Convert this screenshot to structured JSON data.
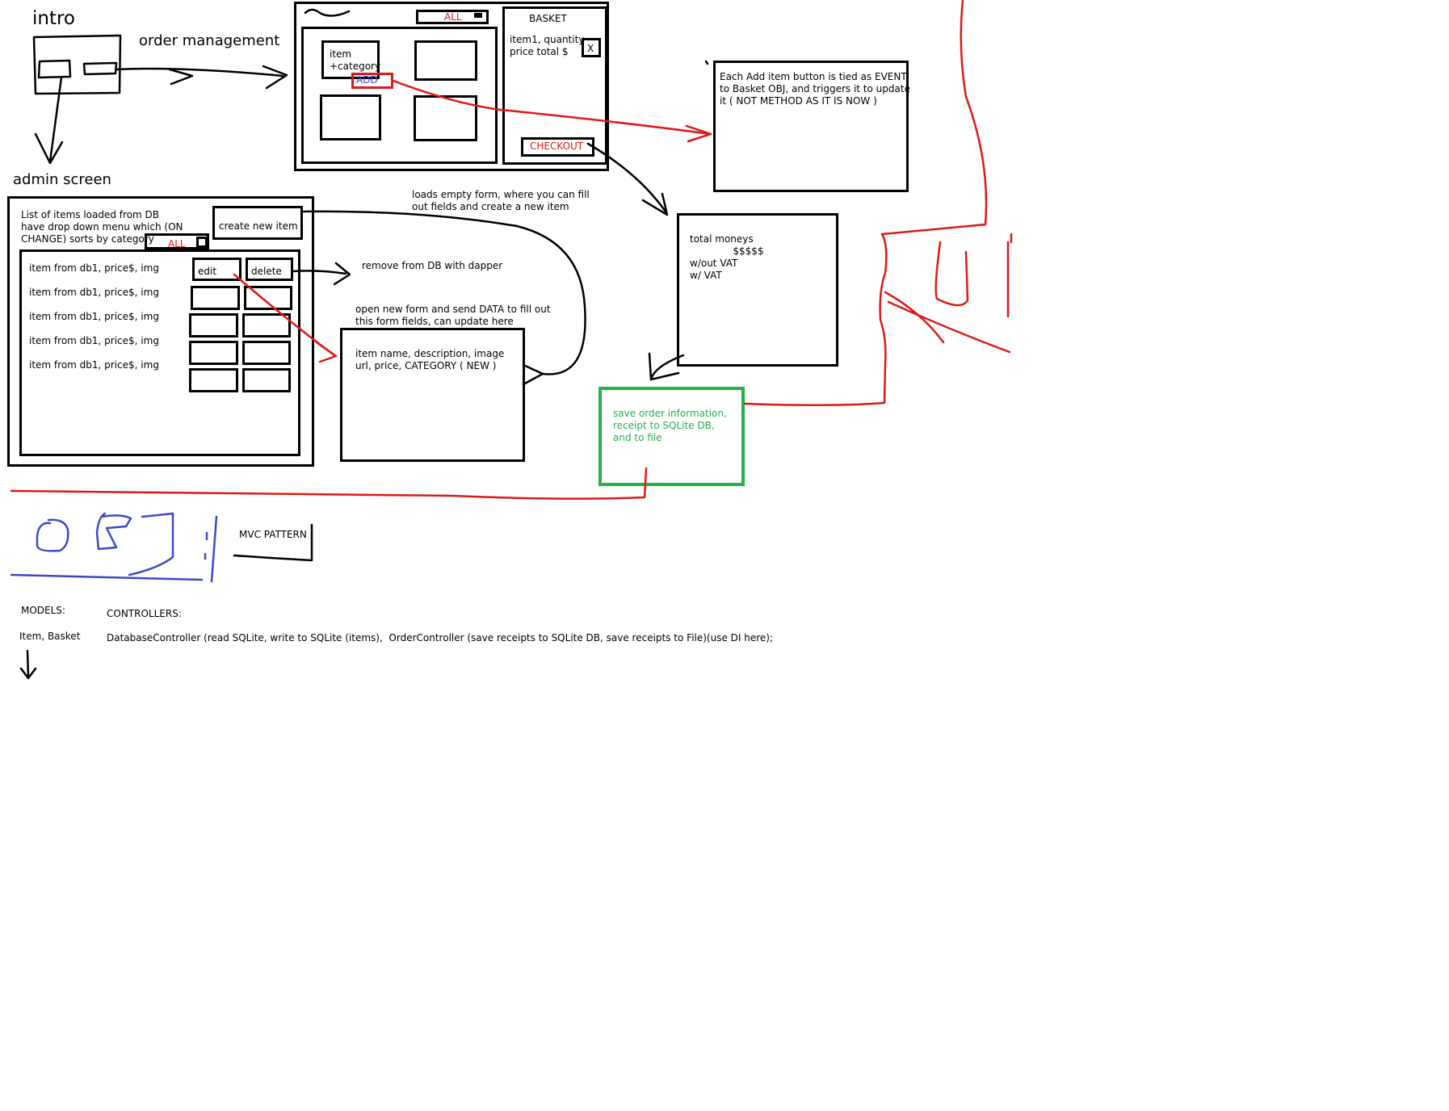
{
  "intro": {
    "title": "intro"
  },
  "order_management": {
    "label": "order management"
  },
  "admin_screen": {
    "label": "admin screen"
  },
  "order_screen": {
    "filter_value": "ALL",
    "item_label": "item\n+category",
    "add_label": "ADD",
    "basket": {
      "title": "BASKET",
      "line": "item1, quantity\nprice total $",
      "remove_label": "X",
      "checkout_label": "CHECKOUT"
    }
  },
  "event_note": "Each Add item button is tied as EVENT\nto Basket OBJ, and triggers it to update\nit ( NOT METHOD AS IT IS NOW )",
  "totals": {
    "text": "total moneys\n              $$$$$\nw/out VAT\nw/ VAT"
  },
  "admin_panel": {
    "description": "List of items loaded from DB\nhave drop down menu which (ON\nCHANGE) sorts by category",
    "create_label": "create new item",
    "filter_value": "ALL",
    "rows": [
      "item from db1, price$, img",
      "item from db1, price$, img",
      "item from db1, price$, img",
      "item from db1, price$, img",
      "item from db1, price$, img"
    ],
    "edit_label": "edit",
    "delete_label": "delete"
  },
  "notes": {
    "loads_empty_form": "loads empty form, where you can fill\nout fields and create a new item",
    "remove_from_db": "remove from DB with dapper",
    "open_new_form": "open new form and send DATA to fill out\nthis form fields, can update here"
  },
  "item_form": {
    "text": "item name, description, image\nurl, price, CATEGORY ( NEW )"
  },
  "save_order": {
    "text": "save order information,\nreceipt to SQLite DB,\nand to file"
  },
  "mvc": {
    "label": "MVC PATTERN",
    "handwriting": "OBJ"
  },
  "models": {
    "header": "MODELS:",
    "list": "Item, Basket"
  },
  "controllers": {
    "header": "CONTROLLERS:",
    "list": "DatabaseController (read SQLite, write to SQLite (items),  OrderController (save receipts to SQLite DB, save receipts to File)(use DI here);"
  },
  "handwriting_ui": "UI",
  "colors": {
    "ink": "#000000",
    "red": "#e01818",
    "blue": "#3f48cc",
    "green": "#22b14c"
  }
}
